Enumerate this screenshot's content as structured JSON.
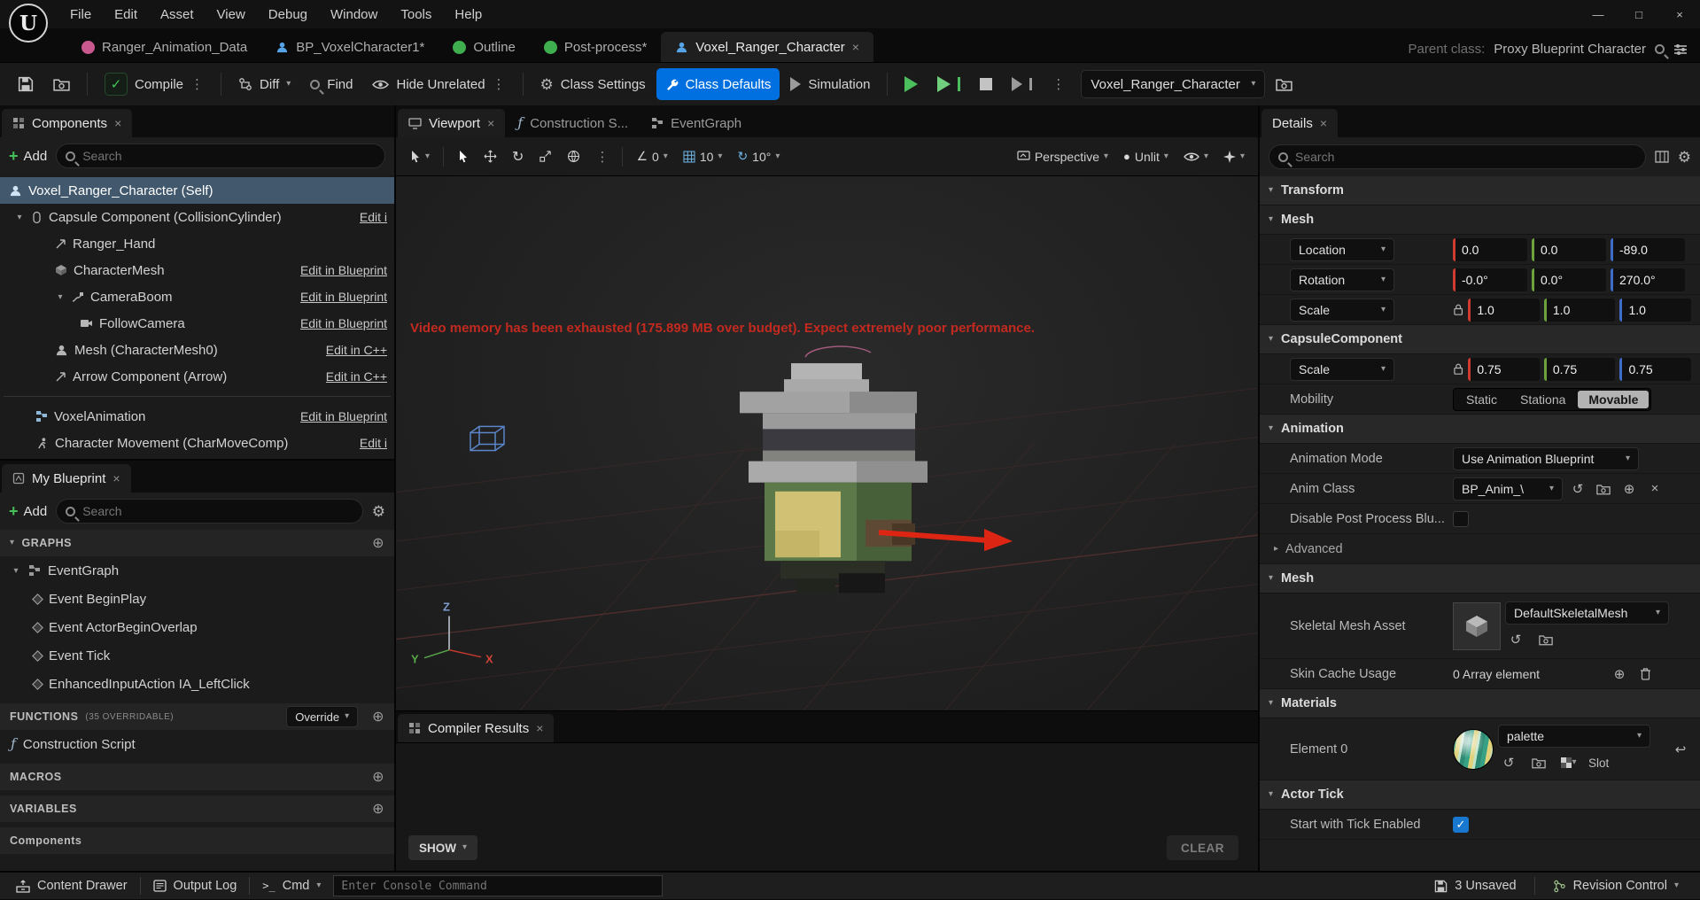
{
  "icons": {
    "close": "×",
    "chevron_down": "▾",
    "chevron_right": "▸",
    "gear": "⚙",
    "plus_circle": "⊕",
    "plus": "+",
    "check": "✓",
    "dots": "⋮",
    "menu": "≡",
    "use_asset": "↺",
    "undo": "↩",
    "rotate_tool": "↻",
    "function_glyph": "ƒ",
    "minimize": "—",
    "maximize": "□",
    "angle": "∠",
    "unlit_dot": "●",
    "prompt": ">_"
  },
  "menubar": {
    "items": [
      "File",
      "Edit",
      "Asset",
      "View",
      "Debug",
      "Window",
      "Tools",
      "Help"
    ]
  },
  "asset_tabs": {
    "tabs": [
      {
        "label": "Ranger_Animation_Data"
      },
      {
        "label": "BP_VoxelCharacter1*"
      },
      {
        "label": "Outline"
      },
      {
        "label": "Post-process*"
      },
      {
        "label": "Voxel_Ranger_Character"
      }
    ],
    "parent_class_label": "Parent class:",
    "parent_class_value": "Proxy Blueprint Character"
  },
  "toolbar": {
    "compile": "Compile",
    "diff": "Diff",
    "find": "Find",
    "hide_unrelated": "Hide Unrelated",
    "class_settings": "Class Settings",
    "class_defaults": "Class Defaults",
    "simulation": "Simulation",
    "debug_target": "Voxel_Ranger_Character"
  },
  "components_panel": {
    "tab": "Components",
    "add": "Add",
    "search_placeholder": "Search",
    "tree": [
      {
        "label": "Voxel_Ranger_Character (Self)",
        "edit": ""
      },
      {
        "label": "Capsule Component (CollisionCylinder)",
        "edit": "Edit i"
      },
      {
        "label": "Ranger_Hand",
        "edit": ""
      },
      {
        "label": "CharacterMesh",
        "edit": "Edit in Blueprint"
      },
      {
        "label": "CameraBoom",
        "edit": "Edit in Blueprint"
      },
      {
        "label": "FollowCamera",
        "edit": "Edit in Blueprint"
      },
      {
        "label": "Mesh (CharacterMesh0)",
        "edit": "Edit in C++"
      },
      {
        "label": "Arrow Component (Arrow)",
        "edit": "Edit in C++"
      },
      {
        "label": "VoxelAnimation",
        "edit": "Edit in Blueprint"
      },
      {
        "label": "Character Movement (CharMoveComp)",
        "edit": "Edit i"
      }
    ]
  },
  "my_blueprint": {
    "tab": "My Blueprint",
    "add": "Add",
    "search_placeholder": "Search",
    "graphs_header": "GRAPHS",
    "eventgraph": "EventGraph",
    "events": [
      "Event BeginPlay",
      "Event ActorBeginOverlap",
      "Event Tick",
      "EnhancedInputAction IA_LeftClick"
    ],
    "functions_header": "FUNCTIONS",
    "functions_note": "(35 OVERRIDABLE)",
    "override": "Override",
    "construction": "Construction Script",
    "macros_header": "MACROS",
    "variables_header": "VARIABLES",
    "components_header": "Components"
  },
  "viewport": {
    "tabs": [
      "Viewport",
      "Construction S...",
      "EventGraph"
    ],
    "snap_angle": "0",
    "grid_size": "10",
    "rot_snap": "10°",
    "perspective": "Perspective",
    "lighting": "Unlit",
    "warning": "Video memory has been exhausted (175.899 MB over budget). Expect extremely poor performance.",
    "axis": {
      "x": "X",
      "y": "Y",
      "z": "Z"
    }
  },
  "compiler": {
    "tab": "Compiler Results",
    "show": "SHOW",
    "clear": "CLEAR"
  },
  "details": {
    "tab": "Details",
    "search_placeholder": "Search",
    "transform_header": "Transform",
    "mesh_header": "Mesh",
    "location": {
      "label": "Location",
      "x": "0.0",
      "y": "0.0",
      "z": "-89.0"
    },
    "rotation": {
      "label": "Rotation",
      "x": "-0.0°",
      "y": "0.0°",
      "z": "270.0°"
    },
    "scale": {
      "label": "Scale",
      "x": "1.0",
      "y": "1.0",
      "z": "1.0"
    },
    "capsule_header": "CapsuleComponent",
    "capsule_scale": {
      "label": "Scale",
      "x": "0.75",
      "y": "0.75",
      "z": "0.75"
    },
    "mobility": {
      "label": "Mobility",
      "options": [
        "Static",
        "Stationa",
        "Movable"
      ],
      "selected": "Movable"
    },
    "animation_header": "Animation",
    "animation_mode": {
      "label": "Animation Mode",
      "value": "Use Animation Blueprint"
    },
    "anim_class": {
      "label": "Anim Class",
      "value": "BP_Anim_\\"
    },
    "disable_post_process": {
      "label": "Disable Post Process Blu...",
      "checked": false
    },
    "advanced": "Advanced",
    "mesh2_header": "Mesh",
    "skeletal_mesh": {
      "label": "Skeletal Mesh Asset",
      "value": "DefaultSkeletalMesh"
    },
    "skin_cache": {
      "label": "Skin Cache Usage",
      "value": "0 Array element"
    },
    "materials_header": "Materials",
    "element0": {
      "label": "Element 0",
      "value": "palette",
      "slot": "Slot"
    },
    "actor_tick_header": "Actor Tick",
    "tick_enabled": {
      "label": "Start with Tick Enabled",
      "checked": true
    }
  },
  "statusbar": {
    "content_drawer": "Content Drawer",
    "output_log": "Output Log",
    "cmd": "Cmd",
    "console_placeholder": "Enter Console Command",
    "unsaved": "3 Unsaved",
    "revision": "Revision Control"
  }
}
